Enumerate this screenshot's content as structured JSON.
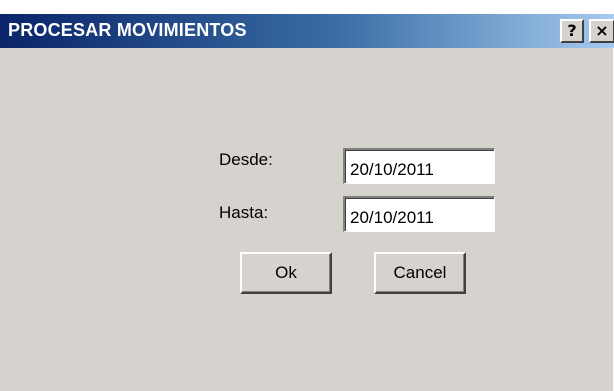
{
  "window": {
    "title": "PROCESAR MOVIMIENTOS",
    "help_icon": "?",
    "close_icon": "×"
  },
  "form": {
    "desde_label": "Desde:",
    "desde_value": "20/10/2011",
    "hasta_label": "Hasta:",
    "hasta_value": "20/10/2011"
  },
  "buttons": {
    "ok_label": "Ok",
    "cancel_label": "Cancel"
  },
  "colors": {
    "title_gradient_start": "#0a246a",
    "title_gradient_end": "#a6caf0",
    "dialog_bg": "#d6d3ce"
  }
}
